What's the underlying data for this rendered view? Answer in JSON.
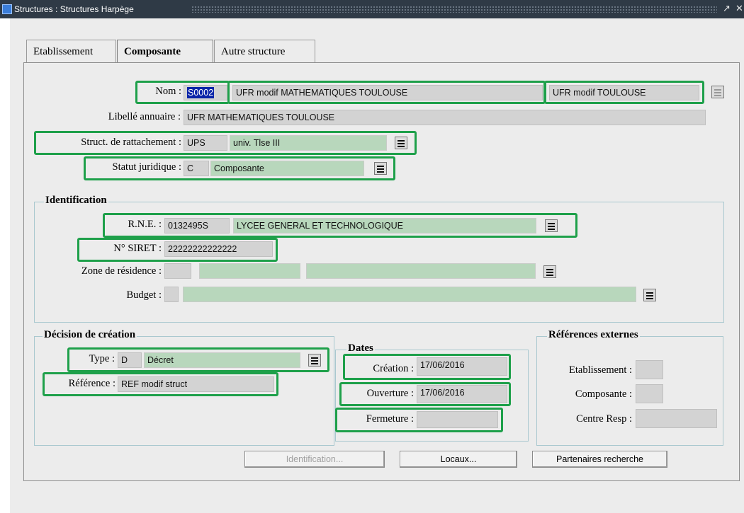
{
  "window": {
    "title": "Structures : Structures Harpège"
  },
  "tabs": [
    "Etablissement",
    "Composante",
    "Autre structure"
  ],
  "main": {
    "nom_label": "Nom :",
    "nom_code": "S0002",
    "nom_long": "UFR modif MATHEMATIQUES TOULOUSE",
    "nom_short": "UFR modif TOULOUSE",
    "libelle_label": "Libellé annuaire :",
    "libelle_value": "UFR MATHEMATIQUES TOULOUSE",
    "rattachement_label": "Struct. de rattachement :",
    "rattachement_code": "UPS",
    "rattachement_value": "univ. Tlse III",
    "statut_label": "Statut juridique :",
    "statut_code": "C",
    "statut_value": "Composante"
  },
  "identification": {
    "title": "Identification",
    "rne_label": "R.N.E. :",
    "rne_code": "0132495S",
    "rne_value": "LYCEE GENERAL ET TECHNOLOGIQUE",
    "siret_label": "N° SIRET :",
    "siret_value": "22222222222222",
    "zone_label": "Zone de résidence :",
    "budget_label": "Budget :"
  },
  "decision": {
    "title": "Décision de création",
    "type_label": "Type :",
    "type_code": "D",
    "type_value": "Décret",
    "reference_label": "Référence :",
    "reference_value": "REF modif struct"
  },
  "dates": {
    "title": "Dates",
    "creation_label": "Création :",
    "creation_value": "17/06/2016",
    "ouverture_label": "Ouverture :",
    "ouverture_value": "17/06/2016",
    "fermeture_label": "Fermeture :"
  },
  "refs": {
    "title": "Références externes",
    "etablissement_label": "Etablissement :",
    "composante_label": "Composante :",
    "centre_label": "Centre Resp :"
  },
  "buttons": {
    "identification": "Identification...",
    "locaux": "Locaux...",
    "partenaires": "Partenaires recherche"
  }
}
